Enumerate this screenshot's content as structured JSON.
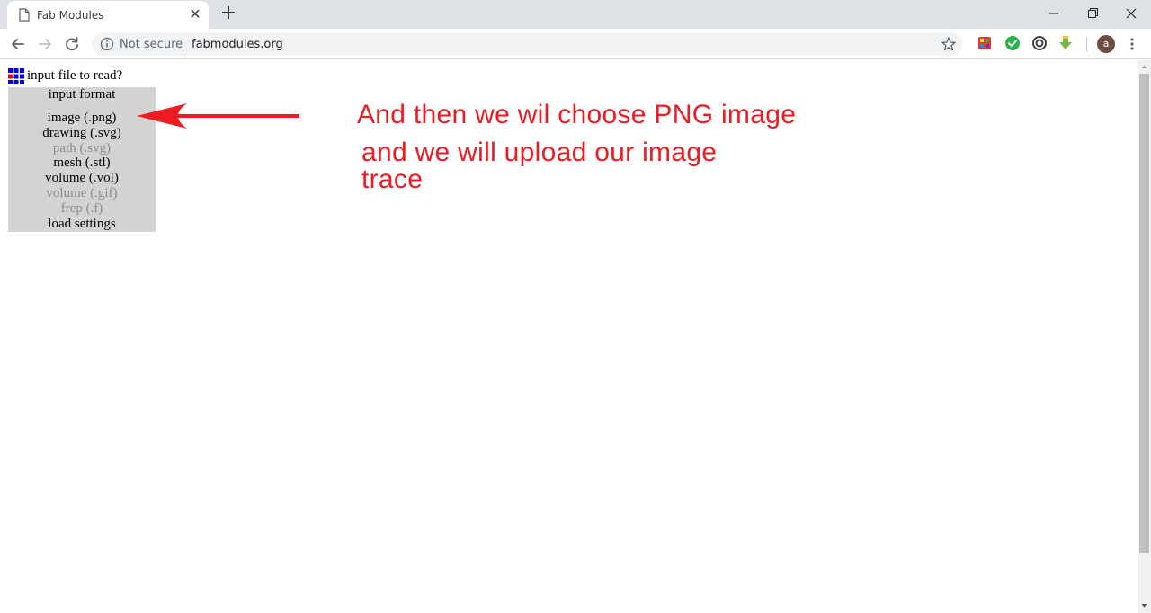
{
  "browser": {
    "tab_title": "Fab Modules",
    "tab_close_glyph": "✕",
    "new_tab_glyph": "+",
    "security_label": "Not secure",
    "url": "fabmodules.org",
    "avatar_letter": "a",
    "icons": {
      "tab": "page-icon",
      "back": "arrow-left-icon",
      "forward": "arrow-right-icon",
      "reload": "reload-icon",
      "info": "info-icon",
      "bookmark": "star-icon",
      "extensions": [
        "colorful-grid-extension-icon",
        "green-check-extension-icon",
        "spiral-extension-icon",
        "green-download-extension-icon"
      ],
      "menu": "three-dots-icon"
    },
    "colors": {
      "tabstrip": "#dee1e6",
      "omnibox": "#f1f3f4"
    }
  },
  "page": {
    "prompt": "input file to read?",
    "format_menu": {
      "heading": "input format",
      "items": [
        {
          "label": "image (.png)",
          "enabled": true
        },
        {
          "label": "drawing (.svg)",
          "enabled": true
        },
        {
          "label": "path (.svg)",
          "enabled": false
        },
        {
          "label": "mesh (.stl)",
          "enabled": true
        },
        {
          "label": "volume (.vol)",
          "enabled": true
        },
        {
          "label": "volume (.gif)",
          "enabled": false
        },
        {
          "label": "frep (.f)",
          "enabled": false
        },
        {
          "label": "load settings",
          "enabled": true
        }
      ]
    },
    "annotations": {
      "line1": "And then we wil choose PNG image",
      "line2": "and we will upload our image",
      "line3": "trace",
      "color": "#ed1c24"
    }
  }
}
